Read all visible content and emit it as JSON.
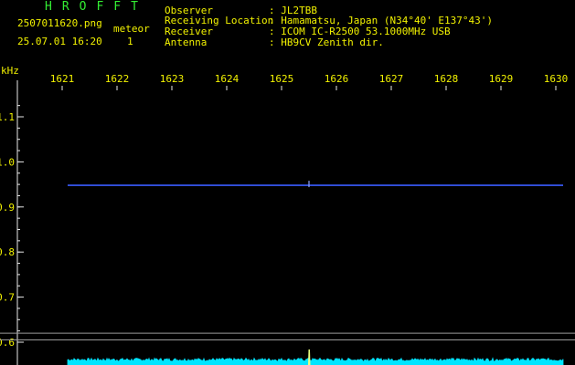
{
  "header": {
    "brand": "HROFFT",
    "filename": "2507011620.png",
    "datetime": "25.07.01 16:20",
    "meteor_label": "meteor",
    "meteor_count": "1",
    "info": [
      {
        "label": "Observer",
        "value": ": JL2TBB"
      },
      {
        "label": "Receiving Location",
        "value": ": Hamamatsu, Japan (N34°40' E137°43')"
      },
      {
        "label": "Receiver",
        "value": ": ICOM IC-R2500 53.1000MHz USB"
      },
      {
        "label": "Antenna",
        "value": ": HB9CV Zenith dir."
      }
    ]
  },
  "colors": {
    "header_green": "#33ee33",
    "label_yellow": "#f2f200",
    "axis_white": "#e8e8e8",
    "signal_blue": "#3a5cff",
    "noise_cyan": "#00e5ff",
    "background": "#000000"
  },
  "chart_data": {
    "type": "spectrogram",
    "ylabel": "kHz",
    "xlabels": [
      "1621",
      "1622",
      "1623",
      "1624",
      "1625",
      "1626",
      "1627",
      "1628",
      "1629",
      "1630"
    ],
    "ylabels": [
      "1.1",
      "1.0",
      "0.9",
      "0.8",
      "0.7",
      "0.6"
    ],
    "x_range": [
      1621,
      1630
    ],
    "y_range": [
      0.59,
      1.15
    ],
    "carrier": {
      "freq_khz": 0.948,
      "x_start": 1621.1,
      "x_end": 1630.0
    },
    "meteor_echo": {
      "x": 1625.5,
      "freq_khz": 0.95
    },
    "level_plot": {
      "reference_lines": [
        0.62,
        0.605
      ],
      "baseline": 0.598,
      "spike_x": 1625.5
    }
  }
}
